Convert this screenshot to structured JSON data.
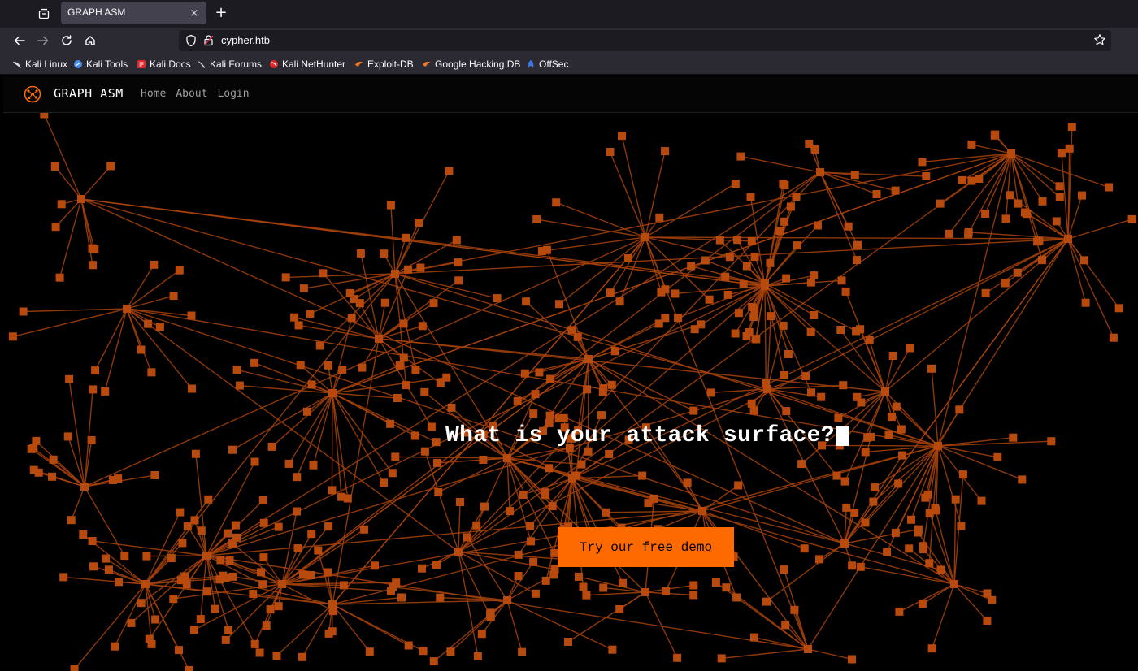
{
  "browser": {
    "tab_title": "GRAPH ASM",
    "tab_close_glyph": "×",
    "new_tab_glyph": "+",
    "url": "cypher.htb",
    "bookmarks": [
      {
        "label": "Kali Linux",
        "icon": "kali-dragon-icon",
        "color": "#e0e0e0"
      },
      {
        "label": "Kali Tools",
        "icon": "kali-tools-icon",
        "color": "#4a8ff0"
      },
      {
        "label": "Kali Docs",
        "icon": "kali-docs-icon",
        "color": "#e0262b"
      },
      {
        "label": "Kali Forums",
        "icon": "kali-forums-icon",
        "color": "#e0e0e0"
      },
      {
        "label": "Kali NetHunter",
        "icon": "nethunter-icon",
        "color": "#e0262b"
      },
      {
        "label": "Exploit-DB",
        "icon": "exploit-db-icon",
        "color": "#f07a2a"
      },
      {
        "label": "Google Hacking DB",
        "icon": "ghdb-icon",
        "color": "#f07a2a"
      },
      {
        "label": "OffSec",
        "icon": "offsec-icon",
        "color": "#3a78e0"
      }
    ]
  },
  "site": {
    "brand": "GRAPH ASM",
    "nav": [
      {
        "label": "Home"
      },
      {
        "label": "About"
      },
      {
        "label": "Login"
      }
    ],
    "headline": "What is your attack surface?",
    "cta_label": "Try our free demo"
  },
  "colors": {
    "accent": "#ff6a00",
    "graph_edge": "#a8420a",
    "graph_node": "#b84a0e"
  }
}
